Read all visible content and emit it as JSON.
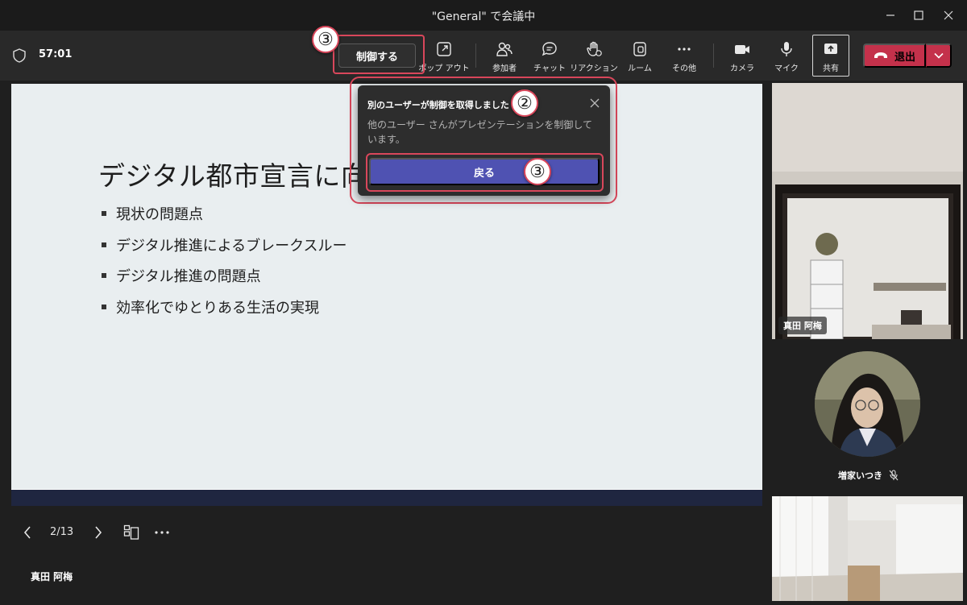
{
  "window": {
    "title": "\"General\" で会議中",
    "controls": [
      "minimize",
      "maximize",
      "close"
    ]
  },
  "toolbar": {
    "timer": "57:01",
    "control_button": "制御する",
    "items": [
      {
        "label": "ポップ アウト",
        "icon": "popout-icon"
      },
      {
        "label": "参加者",
        "icon": "people-icon"
      },
      {
        "label": "チャット",
        "icon": "chat-icon"
      },
      {
        "label": "リアクション",
        "icon": "reaction-hand-icon"
      },
      {
        "label": "ルーム",
        "icon": "rooms-icon"
      },
      {
        "label": "その他",
        "icon": "more-icon"
      },
      {
        "label": "カメラ",
        "icon": "camera-icon"
      },
      {
        "label": "マイク",
        "icon": "mic-icon"
      },
      {
        "label": "共有",
        "icon": "share-icon"
      }
    ],
    "leave_button": "退出"
  },
  "popup": {
    "title": "別のユーザーが制御を取得しました",
    "body": "他のユーザー さんがプレゼンテーションを制御しています。",
    "button": "戻る"
  },
  "annotations": {
    "control_marker": "③",
    "popup_marker": "②",
    "back_marker": "③"
  },
  "slide": {
    "title": "デジタル都市宣言に向け",
    "bullets": [
      "現状の問題点",
      "デジタル推進によるブレークスルー",
      "デジタル推進の問題点",
      "効率化でゆとりある生活の実現"
    ]
  },
  "slide_nav": {
    "page": "2/13"
  },
  "presenter": {
    "name": "真田 阿梅"
  },
  "participants": [
    {
      "name": "真田 阿梅"
    },
    {
      "name": "増家いつき",
      "muted": true
    },
    {
      "name": ""
    }
  ],
  "colors": {
    "accent": "#4f52b2",
    "leave": "#c4314b",
    "annotation": "#d9475b",
    "background": "#1f1f1f",
    "slide_bg": "#e9eef0"
  }
}
